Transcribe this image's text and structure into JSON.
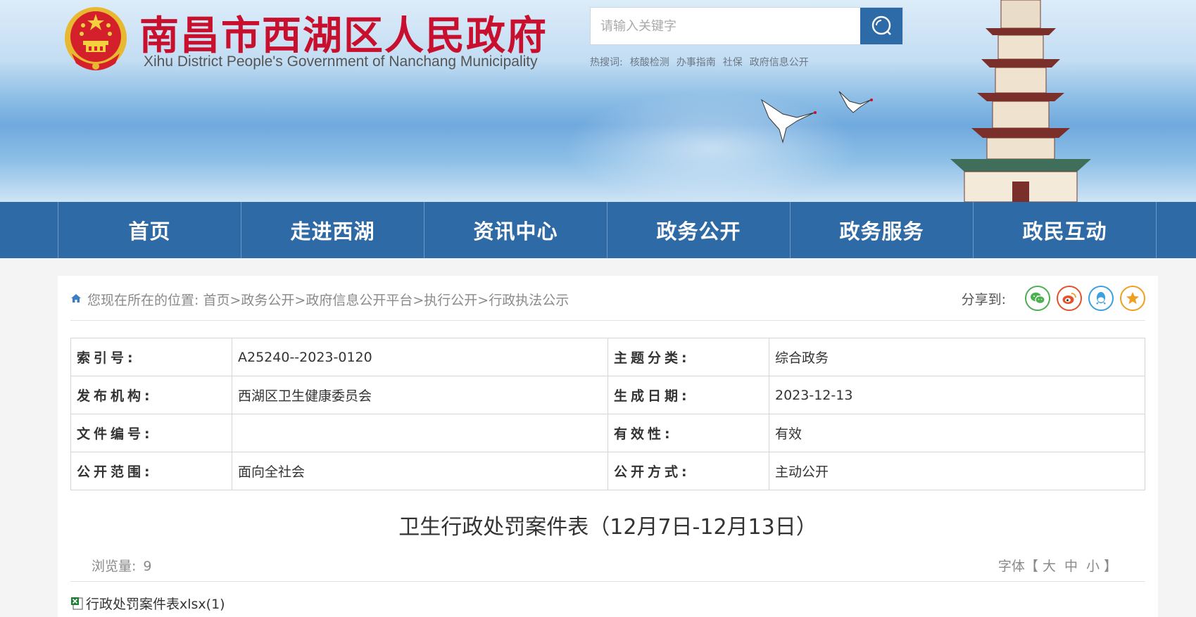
{
  "header": {
    "title": "南昌市西湖区人民政府",
    "subtitle": "Xihu District People's Government of Nanchang Municipality",
    "search": {
      "placeholder": "请输入关键字"
    },
    "hot_label": "热搜词:",
    "hot_words": [
      "核酸检测",
      "办事指南",
      "社保",
      "政府信息公开"
    ]
  },
  "nav": {
    "items": [
      "首页",
      "走进西湖",
      "资讯中心",
      "政务公开",
      "政务服务",
      "政民互动"
    ]
  },
  "breadcrumb": {
    "prefix": "您现在所在的位置:",
    "items": [
      "首页",
      "政务公开",
      "政府信息公开平台",
      "执行公开",
      "行政执法公示"
    ],
    "separator": ">"
  },
  "share": {
    "label": "分享到:"
  },
  "meta": {
    "rows": [
      {
        "k1": "索引号:",
        "v1": "A25240--2023-0120",
        "k2": "主题分类:",
        "v2": "综合政务"
      },
      {
        "k1": "发布机构:",
        "v1": "西湖区卫生健康委员会",
        "k2": "生成日期:",
        "v2": "2023-12-13"
      },
      {
        "k1": "文件编号:",
        "v1": "",
        "k2": "有效性:",
        "v2": "有效"
      },
      {
        "k1": "公开范围:",
        "v1": "面向全社会",
        "k2": "公开方式:",
        "v2": "主动公开"
      }
    ]
  },
  "document": {
    "title": "卫生行政处罚案件表（12月7日-12月13日）",
    "views_label": "浏览量:",
    "views": "9",
    "font_label_open": "字体【",
    "font_large": "大",
    "font_medium": "中",
    "font_small": "小",
    "font_label_close": "】",
    "attachment": "行政处罚案件表xlsx(1)"
  },
  "colors": {
    "nav_bg": "#2e6aa6",
    "title_red": "#c8102e",
    "wechat": "#4caf50",
    "weibo": "#e6512d",
    "qq": "#3aa0e0",
    "qzone": "#f0a020"
  }
}
